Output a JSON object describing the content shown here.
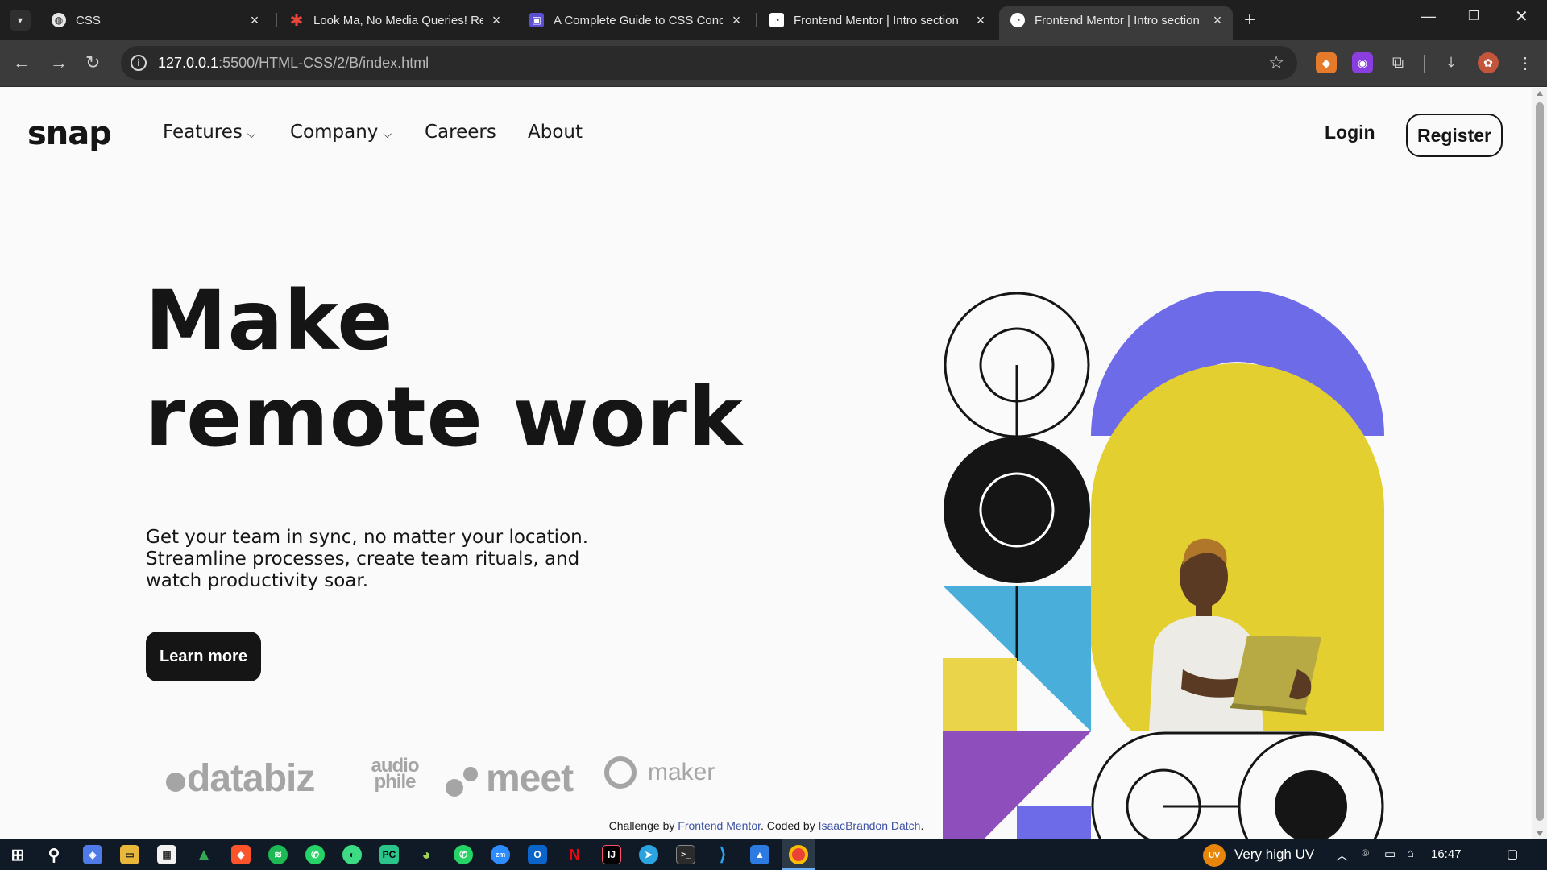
{
  "browser": {
    "tabs": [
      {
        "title": "CSS",
        "favicon": "globe-icon"
      },
      {
        "title": "Look Ma, No Media Queries! Re",
        "favicon": "asterisk-icon"
      },
      {
        "title": "A Complete Guide to CSS Conc",
        "favicon": "floppy-icon"
      },
      {
        "title": "Frontend Mentor | Intro section",
        "favicon": "fm-icon"
      },
      {
        "title": "Frontend Mentor | Intro section",
        "favicon": "fm-icon",
        "active": true
      }
    ],
    "url_host": "127.0.0.1",
    "url_path": ":5500/HTML-CSS/2/B/index.html",
    "new_tab": "+"
  },
  "nav": {
    "logo": "snap",
    "items": [
      {
        "label": "Features",
        "dropdown": true
      },
      {
        "label": "Company",
        "dropdown": true
      },
      {
        "label": "Careers",
        "dropdown": false
      },
      {
        "label": "About",
        "dropdown": false
      }
    ],
    "login": "Login",
    "register": "Register"
  },
  "hero": {
    "headline_line1": "Make",
    "headline_line2": "remote work",
    "lede": "Get your team in sync, no matter your location. Streamline processes, create team rituals, and watch productivity soar.",
    "cta": "Learn more",
    "clients": [
      "databiz",
      "audio phile",
      "meet",
      "maker"
    ]
  },
  "footer": {
    "prefix": "Challenge by ",
    "challenge_link": "Frontend Mentor",
    "middle": ". Coded by ",
    "author_link": "IsaacBrandon Datch",
    "suffix": "."
  },
  "taskbar": {
    "weather_badge": "UV",
    "weather": "Very high UV",
    "time": "16:47"
  },
  "colors": {
    "accent_purple": "#6d6be8",
    "accent_yellow": "#e3cf2f",
    "accent_blue": "#4aaedb",
    "accent_violet": "#8e4fbd",
    "ink": "#151515"
  }
}
